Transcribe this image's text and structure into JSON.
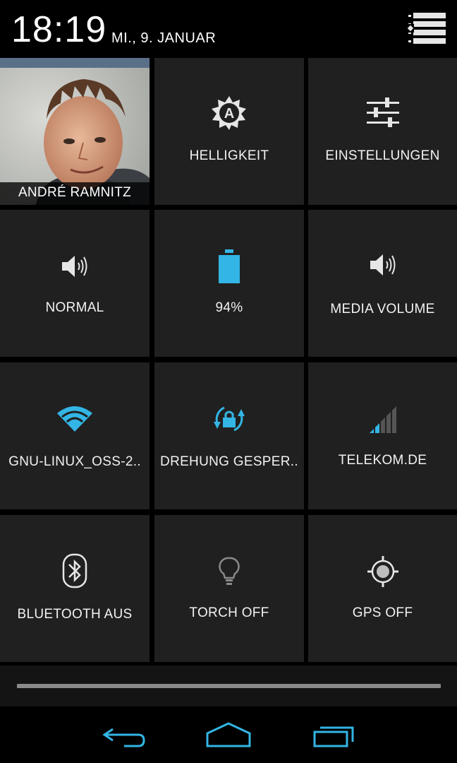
{
  "status": {
    "time": "18:19",
    "date": "MI., 9. JANUAR"
  },
  "user": {
    "name": "ANDRÉ RAMNITZ"
  },
  "tiles": [
    {
      "label": "HELLIGKEIT",
      "icon": "brightness-auto-icon"
    },
    {
      "label": "EINSTELLUNGEN",
      "icon": "settings-sliders-icon"
    },
    {
      "label": "NORMAL",
      "icon": "ringer-volume-icon"
    },
    {
      "label": "94%",
      "icon": "battery-icon",
      "level": 0.94
    },
    {
      "label": "MEDIA VOLUME",
      "icon": "media-volume-icon"
    },
    {
      "label": "GNU-LINUX_OSS-2..",
      "icon": "wifi-icon"
    },
    {
      "label": "DREHUNG GESPER..",
      "icon": "rotation-lock-icon"
    },
    {
      "label": "TELEKOM.DE",
      "icon": "signal-icon"
    },
    {
      "label": "BLUETOOTH AUS",
      "icon": "bluetooth-icon"
    },
    {
      "label": "TORCH OFF",
      "icon": "torch-icon"
    },
    {
      "label": "GPS OFF",
      "icon": "gps-icon"
    }
  ],
  "colors": {
    "accent": "#33b5e5",
    "tile_bg": "#202020",
    "text": "#f2f2f2"
  },
  "navbar": {
    "back": "back-icon",
    "home": "home-icon",
    "recents": "recents-icon"
  }
}
